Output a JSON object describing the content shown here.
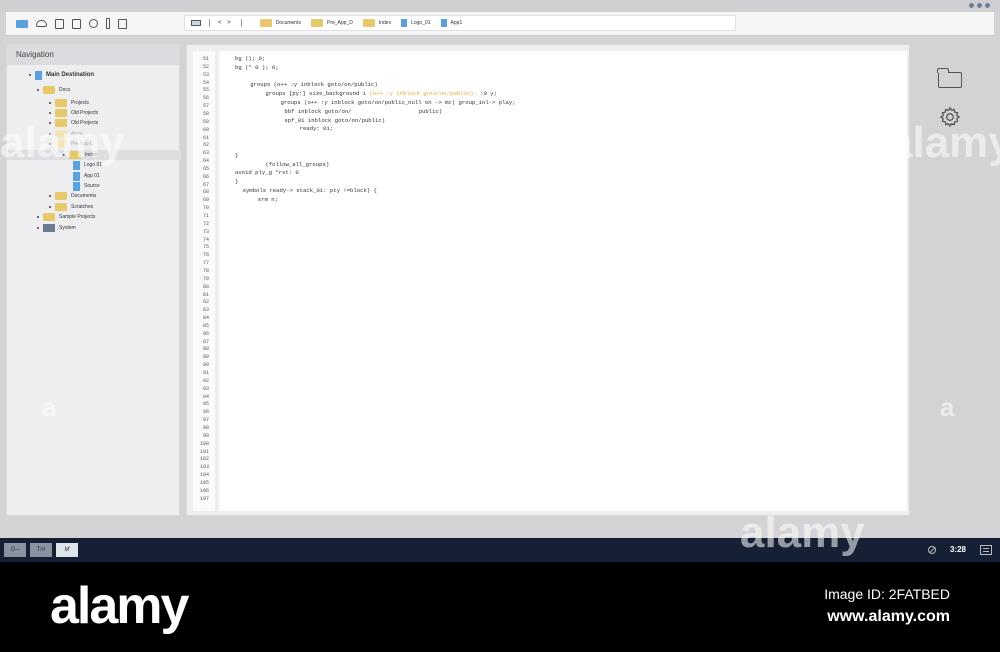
{
  "toolbar": {
    "nav_arrows": "< >",
    "breadcrumbs": [
      {
        "label": "Documents",
        "kind": "folder"
      },
      {
        "label": "Pre_App_D",
        "kind": "folder"
      },
      {
        "label": "Index",
        "kind": "folder"
      },
      {
        "label": "Logo_01",
        "kind": "file"
      },
      {
        "label": "App1",
        "kind": "file"
      }
    ]
  },
  "nav": {
    "title": "Navigation",
    "main": "Main Destination",
    "tree": [
      {
        "label": "Docs",
        "kind": "folder"
      },
      {
        "label": "Projects",
        "kind": "folder"
      },
      {
        "label": "Old Projects",
        "kind": "folder"
      },
      {
        "label": "Old Projects",
        "kind": "folder"
      },
      {
        "label": "Apps",
        "kind": "folder"
      },
      {
        "label": "Pre App D",
        "kind": "folder"
      },
      {
        "label": "Index",
        "kind": "folder"
      },
      {
        "label": "Logo 01",
        "kind": "file"
      },
      {
        "label": "App 01",
        "kind": "file"
      },
      {
        "label": "Source",
        "kind": "file"
      },
      {
        "label": "Documents",
        "kind": "folder"
      },
      {
        "label": "Scratches",
        "kind": "folder"
      },
      {
        "label": "Sample Projects",
        "kind": "folder"
      },
      {
        "label": "System",
        "kind": "system"
      }
    ]
  },
  "editor": {
    "line_numbers": [
      "51",
      "52",
      "53",
      "54",
      "55",
      "56",
      "57",
      "58",
      "59",
      "60",
      "61",
      "62",
      "63",
      "64",
      "65",
      "66",
      "67",
      "68",
      "69",
      "70",
      "71",
      "72",
      "73",
      "74",
      "75",
      "76",
      "77",
      "78",
      "79",
      "80",
      "81",
      "82",
      "83",
      "84",
      "85",
      "86",
      "87",
      "88",
      "89",
      "90",
      "91",
      "92",
      "93",
      "94",
      "95",
      "96",
      "97",
      "98",
      "99",
      "100",
      "101",
      "102",
      "103",
      "104",
      "105",
      "106",
      "107"
    ],
    "code_lines": [
      {
        "text": "bg (); 0;",
        "indent": 0
      },
      {
        "text": "bg (* 0 ); 0;",
        "indent": 0
      },
      {
        "text": "",
        "indent": 0
      },
      {
        "text": "groups (o++ :y inblock goto/on/public)",
        "indent": 4
      },
      {
        "text": "groups [py:] size_background i ",
        "hl": "(o++ :y inblock goto/on/public):",
        "tail": " :0 y;",
        "indent": 8
      },
      {
        "text": "groups (o++ :y inblock goto/on/public_null on -> mc) group_inl-> play;",
        "indent": 12
      },
      {
        "text": "bbf inblock goto/on/                    public)",
        "indent": 13
      },
      {
        "text": "spf_01 inblock goto/on/public)",
        "indent": 13
      },
      {
        "text": "ready: 01;",
        "indent": 17
      },
      {
        "text": "",
        "indent": 0
      },
      {
        "text": "",
        "indent": 0
      },
      {
        "text": "}",
        "indent": 0
      },
      {
        "text": "(follow_all_groups)",
        "indent": 8
      },
      {
        "text": "avoid ply_g *rst: 0",
        "indent": 0
      },
      {
        "text": "}",
        "indent": 0
      },
      {
        "text": "symbols ready-> stack_01: pty !=block) {",
        "indent": 2
      },
      {
        "text": "srm n;",
        "indent": 6
      }
    ]
  },
  "taskbar": {
    "buttons": [
      "O─",
      "Tm",
      "M"
    ],
    "clock": "3:28"
  },
  "footer": {
    "brand": "alamy",
    "image_id": "Image ID: 2FATBED",
    "url": "www.alamy.com"
  },
  "colors": {
    "folder": "#e8c96a",
    "file": "#5aa0dd",
    "taskbar": "#152035",
    "code_highlight": "#e0a630"
  }
}
